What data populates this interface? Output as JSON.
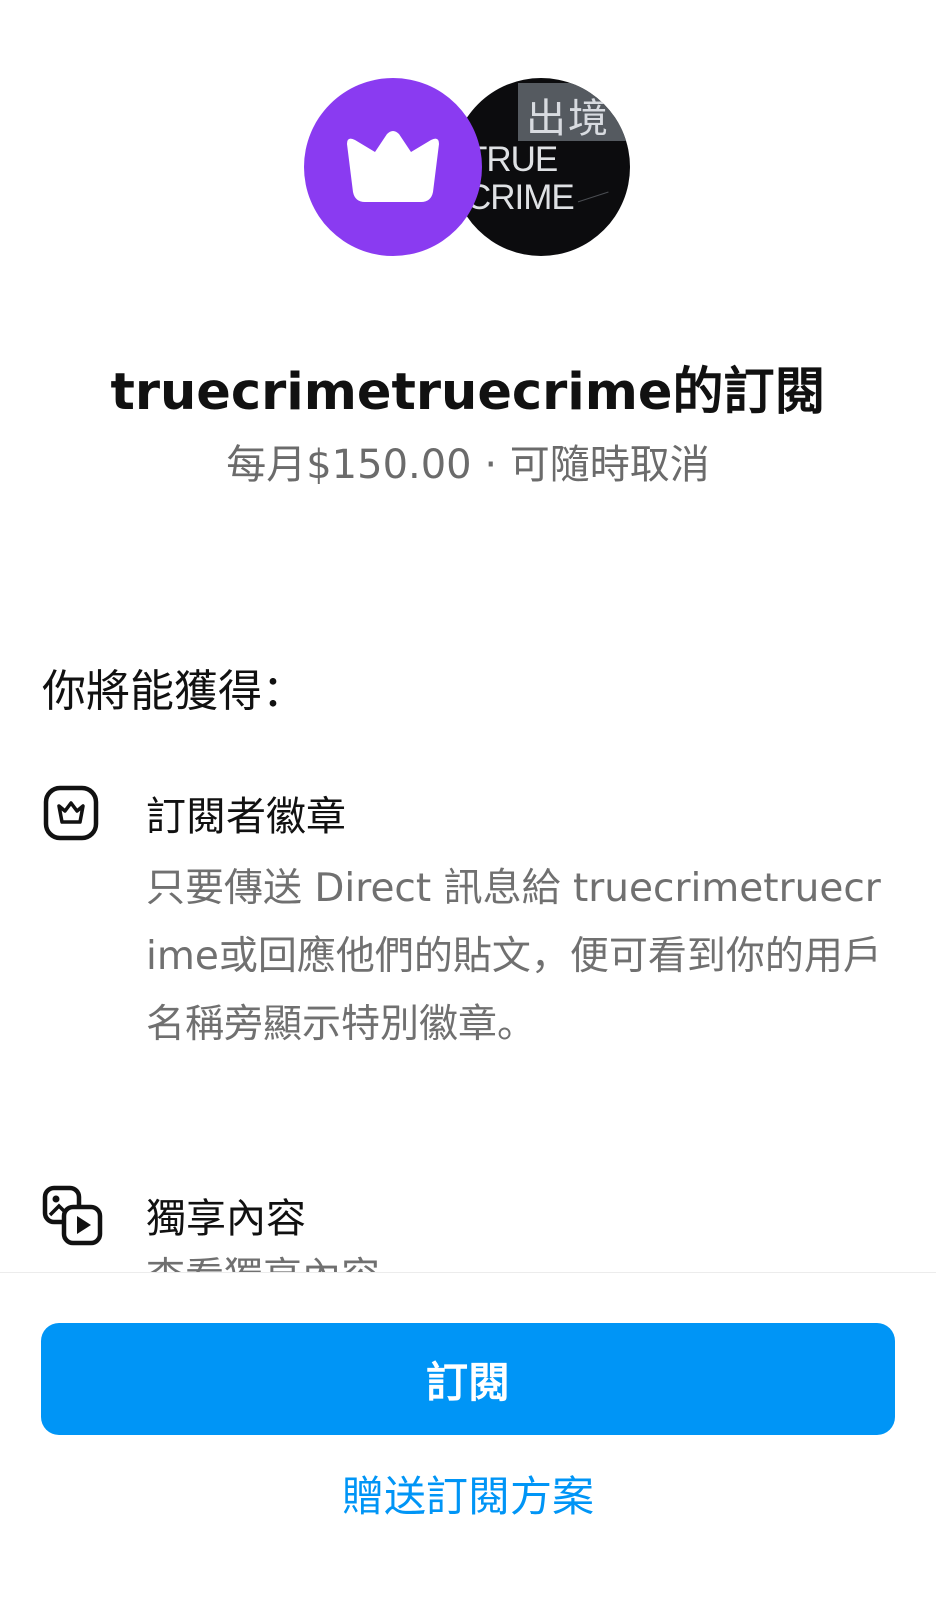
{
  "header": {
    "creator_avatar_text": {
      "kanji": "出境",
      "line1": "TRUE",
      "line2": "CRIME"
    },
    "title": "truecrimetruecrime的訂閱",
    "subtitle": "每月$150.00 · 可隨時取消"
  },
  "benefits": {
    "heading": "你將能獲得：",
    "items": [
      {
        "icon": "crown-badge-icon",
        "title": "訂閱者徽章",
        "description": "只要傳送 Direct 訊息給 truecrimetruecrime或回應他們的貼文，便可看到你的用戶名稱旁顯示特別徽章。"
      },
      {
        "icon": "media-content-icon",
        "title": "獨享內容",
        "description": "查看獨享內容"
      }
    ]
  },
  "footer": {
    "subscribe_label": "訂閱",
    "gift_label": "贈送訂閱方案"
  },
  "colors": {
    "accent_purple": "#8a3bf1",
    "primary_blue": "#0095f6"
  }
}
